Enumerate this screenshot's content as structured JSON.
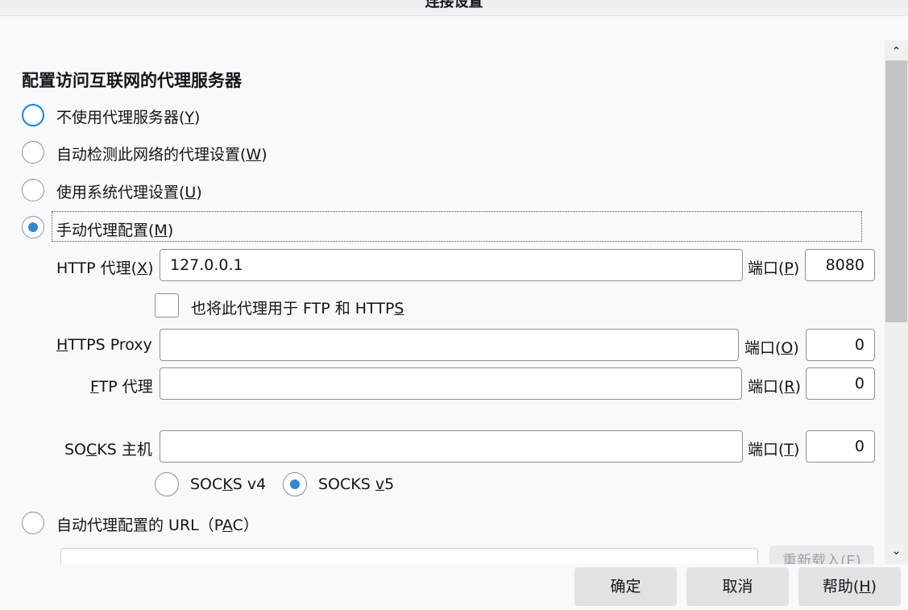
{
  "window": {
    "title": "连接设置"
  },
  "section_title": "配置访问互联网的代理服务器",
  "proxy_options": {
    "none": {
      "label": "不使用代理服务器(",
      "key": "Y",
      "end": ")"
    },
    "auto_detect": {
      "label": "自动检测此网络的代理设置(",
      "key": "W",
      "end": ")"
    },
    "system": {
      "label": "使用系统代理设置(",
      "key": "U",
      "end": ")"
    },
    "manual": {
      "label": "手动代理配置(",
      "key": "M",
      "end": ")"
    },
    "pac": {
      "label": "自动代理配置的 URL（",
      "pre": "P",
      "key": "A",
      "post": "C）"
    }
  },
  "http": {
    "label_pre": "HTTP 代理(",
    "key": "X",
    "end": ")",
    "value": "127.0.0.1",
    "port_label": "端口(",
    "port_key": "P",
    "port_end": ")",
    "port_value": "8080"
  },
  "also_use": {
    "label_pre": "也将此代理用于 FTP 和 HTTP",
    "key": "S"
  },
  "https": {
    "key": "H",
    "label_post": "TTPS Proxy",
    "value": "",
    "port_label": "端口(",
    "port_key": "O",
    "port_end": ")",
    "port_value": "0"
  },
  "ftp": {
    "key": "F",
    "label_post": "TP 代理",
    "value": "",
    "port_label": "端口(",
    "port_key": "R",
    "port_end": ")",
    "port_value": "0"
  },
  "socks": {
    "label_pre": "SO",
    "key": "C",
    "label_post": "KS 主机",
    "value": "",
    "port_label": "端口(",
    "port_key": "T",
    "port_end": ")",
    "port_value": "0"
  },
  "socks_v4": {
    "pre": "SOC",
    "key": "K",
    "post": "S v4"
  },
  "socks_v5": {
    "pre": "SOCKS ",
    "key": "v",
    "post": "5"
  },
  "reload_button": "重新载入(E)",
  "buttons": {
    "ok": "确定",
    "cancel": "取消",
    "help_pre": "帮助(",
    "help_key": "H",
    "help_end": ")"
  },
  "colors": {
    "accent": "#0a84ff",
    "radio_fill": "#2e8ad8",
    "button_bg": "#e2e2e6"
  }
}
